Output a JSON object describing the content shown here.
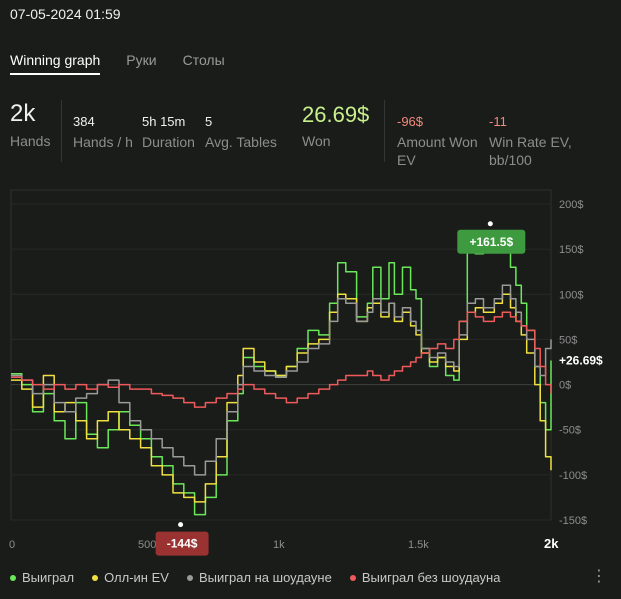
{
  "header": {
    "datetime": "07-05-2024 01:59"
  },
  "tabs": [
    {
      "label": "Winning graph",
      "active": true
    },
    {
      "label": "Руки",
      "active": false
    },
    {
      "label": "Столы",
      "active": false
    }
  ],
  "stats": {
    "hands": {
      "value": "2k",
      "label": "Hands"
    },
    "hands_per_hour": {
      "value": "384",
      "label": "Hands / h"
    },
    "duration": {
      "value": "5h 15m",
      "label": "Duration"
    },
    "avg_tables": {
      "value": "5",
      "label": "Avg. Tables"
    },
    "won": {
      "value": "26.69$",
      "label": "Won"
    },
    "amount_won_ev": {
      "value": "-96$",
      "label": "Amount Won EV"
    },
    "win_rate_ev": {
      "value": "-11",
      "label": "Win Rate EV, bb/100"
    }
  },
  "legend": [
    {
      "label": "Выиграл",
      "color": "#6be85a"
    },
    {
      "label": "Олл-ин EV",
      "color": "#f0e040"
    },
    {
      "label": "Выиграл на шоудауне",
      "color": "#9a9a9a"
    },
    {
      "label": "Выиграл без шоудауна",
      "color": "#f05a5a"
    }
  ],
  "chart_data": {
    "type": "line",
    "xlim": [
      0,
      2000
    ],
    "ylim": [
      -150,
      200
    ],
    "x_ticks": [
      {
        "value": 0,
        "label": "0"
      },
      {
        "value": 500,
        "label": "500"
      },
      {
        "value": 1000,
        "label": "1k"
      },
      {
        "value": 1500,
        "label": "1.5k"
      },
      {
        "value": 2000,
        "label": "2k"
      }
    ],
    "y_ticks": [
      {
        "value": 200,
        "label": "200$"
      },
      {
        "value": 150,
        "label": "150$"
      },
      {
        "value": 100,
        "label": "100$"
      },
      {
        "value": 50,
        "label": "50$"
      },
      {
        "value": 0,
        "label": "0$"
      },
      {
        "value": -50,
        "label": "-50$"
      },
      {
        "value": -100,
        "label": "-100$"
      },
      {
        "value": -150,
        "label": "-150$"
      }
    ],
    "annotations": {
      "max": {
        "x": 1790,
        "y": 161.5,
        "label": "+161.5$"
      },
      "min": {
        "x": 680,
        "y": -144,
        "label": "-144$"
      },
      "final": {
        "x": 2000,
        "y": 26.69,
        "label": "+26.69$"
      }
    },
    "series": [
      {
        "name": "Выиграл",
        "color": "#6be85a",
        "points": [
          [
            0,
            12
          ],
          [
            40,
            0
          ],
          [
            80,
            -30
          ],
          [
            120,
            -10
          ],
          [
            160,
            -40
          ],
          [
            200,
            -60
          ],
          [
            240,
            -20
          ],
          [
            280,
            -55
          ],
          [
            320,
            -70
          ],
          [
            360,
            -50
          ],
          [
            400,
            -30
          ],
          [
            440,
            -45
          ],
          [
            480,
            -60
          ],
          [
            520,
            -80
          ],
          [
            560,
            -90
          ],
          [
            600,
            -110
          ],
          [
            640,
            -120
          ],
          [
            680,
            -144
          ],
          [
            720,
            -125
          ],
          [
            760,
            -100
          ],
          [
            800,
            -40
          ],
          [
            840,
            -10
          ],
          [
            860,
            30
          ],
          [
            900,
            20
          ],
          [
            940,
            15
          ],
          [
            980,
            10
          ],
          [
            1020,
            20
          ],
          [
            1060,
            40
          ],
          [
            1100,
            60
          ],
          [
            1140,
            55
          ],
          [
            1180,
            90
          ],
          [
            1210,
            135
          ],
          [
            1240,
            125
          ],
          [
            1280,
            75
          ],
          [
            1320,
            90
          ],
          [
            1340,
            130
          ],
          [
            1370,
            95
          ],
          [
            1400,
            135
          ],
          [
            1420,
            100
          ],
          [
            1450,
            130
          ],
          [
            1480,
            105
          ],
          [
            1500,
            95
          ],
          [
            1520,
            40
          ],
          [
            1550,
            20
          ],
          [
            1580,
            30
          ],
          [
            1610,
            10
          ],
          [
            1640,
            5
          ],
          [
            1660,
            70
          ],
          [
            1690,
            155
          ],
          [
            1720,
            145
          ],
          [
            1750,
            150
          ],
          [
            1790,
            161.5
          ],
          [
            1820,
            150
          ],
          [
            1850,
            130
          ],
          [
            1870,
            110
          ],
          [
            1890,
            90
          ],
          [
            1910,
            60
          ],
          [
            1940,
            20
          ],
          [
            1960,
            -20
          ],
          [
            1980,
            -50
          ],
          [
            2000,
            26.69
          ]
        ]
      },
      {
        "name": "Олл-ин EV",
        "color": "#f0e040",
        "points": [
          [
            0,
            5
          ],
          [
            40,
            -5
          ],
          [
            80,
            -25
          ],
          [
            120,
            10
          ],
          [
            160,
            -30
          ],
          [
            200,
            -20
          ],
          [
            240,
            -40
          ],
          [
            280,
            -60
          ],
          [
            320,
            -40
          ],
          [
            360,
            -30
          ],
          [
            400,
            -50
          ],
          [
            440,
            -60
          ],
          [
            480,
            -70
          ],
          [
            520,
            -90
          ],
          [
            560,
            -100
          ],
          [
            600,
            -120
          ],
          [
            640,
            -125
          ],
          [
            680,
            -130
          ],
          [
            720,
            -110
          ],
          [
            760,
            -80
          ],
          [
            800,
            -20
          ],
          [
            840,
            10
          ],
          [
            860,
            40
          ],
          [
            900,
            25
          ],
          [
            940,
            15
          ],
          [
            980,
            10
          ],
          [
            1020,
            20
          ],
          [
            1060,
            35
          ],
          [
            1100,
            45
          ],
          [
            1140,
            50
          ],
          [
            1180,
            80
          ],
          [
            1210,
            100
          ],
          [
            1240,
            95
          ],
          [
            1280,
            70
          ],
          [
            1320,
            85
          ],
          [
            1340,
            90
          ],
          [
            1370,
            75
          ],
          [
            1400,
            90
          ],
          [
            1420,
            70
          ],
          [
            1450,
            80
          ],
          [
            1480,
            65
          ],
          [
            1500,
            55
          ],
          [
            1520,
            35
          ],
          [
            1550,
            25
          ],
          [
            1580,
            30
          ],
          [
            1610,
            20
          ],
          [
            1640,
            15
          ],
          [
            1660,
            50
          ],
          [
            1690,
            80
          ],
          [
            1720,
            85
          ],
          [
            1750,
            80
          ],
          [
            1790,
            90
          ],
          [
            1820,
            100
          ],
          [
            1850,
            85
          ],
          [
            1870,
            70
          ],
          [
            1890,
            55
          ],
          [
            1910,
            35
          ],
          [
            1940,
            0
          ],
          [
            1960,
            -40
          ],
          [
            1980,
            -80
          ],
          [
            2000,
            -95
          ]
        ]
      },
      {
        "name": "Выиграл на шоудауне",
        "color": "#9a9a9a",
        "points": [
          [
            0,
            10
          ],
          [
            40,
            5
          ],
          [
            80,
            -10
          ],
          [
            120,
            0
          ],
          [
            160,
            -20
          ],
          [
            200,
            -30
          ],
          [
            240,
            -15
          ],
          [
            280,
            -10
          ],
          [
            320,
            0
          ],
          [
            360,
            5
          ],
          [
            400,
            -20
          ],
          [
            440,
            -40
          ],
          [
            480,
            -50
          ],
          [
            520,
            -60
          ],
          [
            560,
            -70
          ],
          [
            600,
            -80
          ],
          [
            640,
            -90
          ],
          [
            680,
            -100
          ],
          [
            720,
            -85
          ],
          [
            760,
            -60
          ],
          [
            800,
            -30
          ],
          [
            840,
            0
          ],
          [
            860,
            20
          ],
          [
            900,
            15
          ],
          [
            940,
            10
          ],
          [
            980,
            8
          ],
          [
            1020,
            15
          ],
          [
            1060,
            25
          ],
          [
            1100,
            40
          ],
          [
            1140,
            45
          ],
          [
            1180,
            70
          ],
          [
            1210,
            95
          ],
          [
            1240,
            90
          ],
          [
            1280,
            70
          ],
          [
            1320,
            80
          ],
          [
            1340,
            95
          ],
          [
            1370,
            80
          ],
          [
            1400,
            90
          ],
          [
            1420,
            75
          ],
          [
            1450,
            85
          ],
          [
            1480,
            70
          ],
          [
            1500,
            60
          ],
          [
            1520,
            40
          ],
          [
            1550,
            30
          ],
          [
            1580,
            35
          ],
          [
            1610,
            25
          ],
          [
            1640,
            20
          ],
          [
            1660,
            55
          ],
          [
            1690,
            90
          ],
          [
            1720,
            95
          ],
          [
            1750,
            85
          ],
          [
            1790,
            95
          ],
          [
            1820,
            110
          ],
          [
            1850,
            95
          ],
          [
            1870,
            80
          ],
          [
            1890,
            65
          ],
          [
            1910,
            50
          ],
          [
            1940,
            20
          ],
          [
            1960,
            10
          ],
          [
            1980,
            40
          ],
          [
            2000,
            50
          ]
        ]
      },
      {
        "name": "Выиграл без шоудауна",
        "color": "#f05a5a",
        "points": [
          [
            0,
            8
          ],
          [
            40,
            5
          ],
          [
            80,
            0
          ],
          [
            120,
            -5
          ],
          [
            160,
            0
          ],
          [
            200,
            -5
          ],
          [
            240,
            0
          ],
          [
            280,
            -5
          ],
          [
            320,
            0
          ],
          [
            360,
            -3
          ],
          [
            400,
            0
          ],
          [
            440,
            -5
          ],
          [
            480,
            -5
          ],
          [
            520,
            -10
          ],
          [
            560,
            -12
          ],
          [
            600,
            -15
          ],
          [
            640,
            -20
          ],
          [
            680,
            -25
          ],
          [
            720,
            -20
          ],
          [
            760,
            -15
          ],
          [
            800,
            -10
          ],
          [
            840,
            -5
          ],
          [
            860,
            0
          ],
          [
            900,
            -5
          ],
          [
            940,
            -10
          ],
          [
            980,
            -15
          ],
          [
            1020,
            -20
          ],
          [
            1060,
            -15
          ],
          [
            1100,
            -10
          ],
          [
            1140,
            -5
          ],
          [
            1180,
            0
          ],
          [
            1210,
            5
          ],
          [
            1240,
            10
          ],
          [
            1280,
            10
          ],
          [
            1320,
            15
          ],
          [
            1340,
            10
          ],
          [
            1370,
            5
          ],
          [
            1400,
            10
          ],
          [
            1420,
            15
          ],
          [
            1450,
            20
          ],
          [
            1480,
            25
          ],
          [
            1500,
            30
          ],
          [
            1520,
            35
          ],
          [
            1550,
            40
          ],
          [
            1580,
            45
          ],
          [
            1610,
            40
          ],
          [
            1640,
            50
          ],
          [
            1660,
            70
          ],
          [
            1690,
            80
          ],
          [
            1720,
            75
          ],
          [
            1750,
            70
          ],
          [
            1790,
            75
          ],
          [
            1820,
            80
          ],
          [
            1850,
            75
          ],
          [
            1870,
            70
          ],
          [
            1890,
            65
          ],
          [
            1910,
            60
          ],
          [
            1940,
            40
          ],
          [
            1960,
            20
          ],
          [
            1980,
            0
          ],
          [
            2000,
            -10
          ]
        ]
      }
    ]
  }
}
